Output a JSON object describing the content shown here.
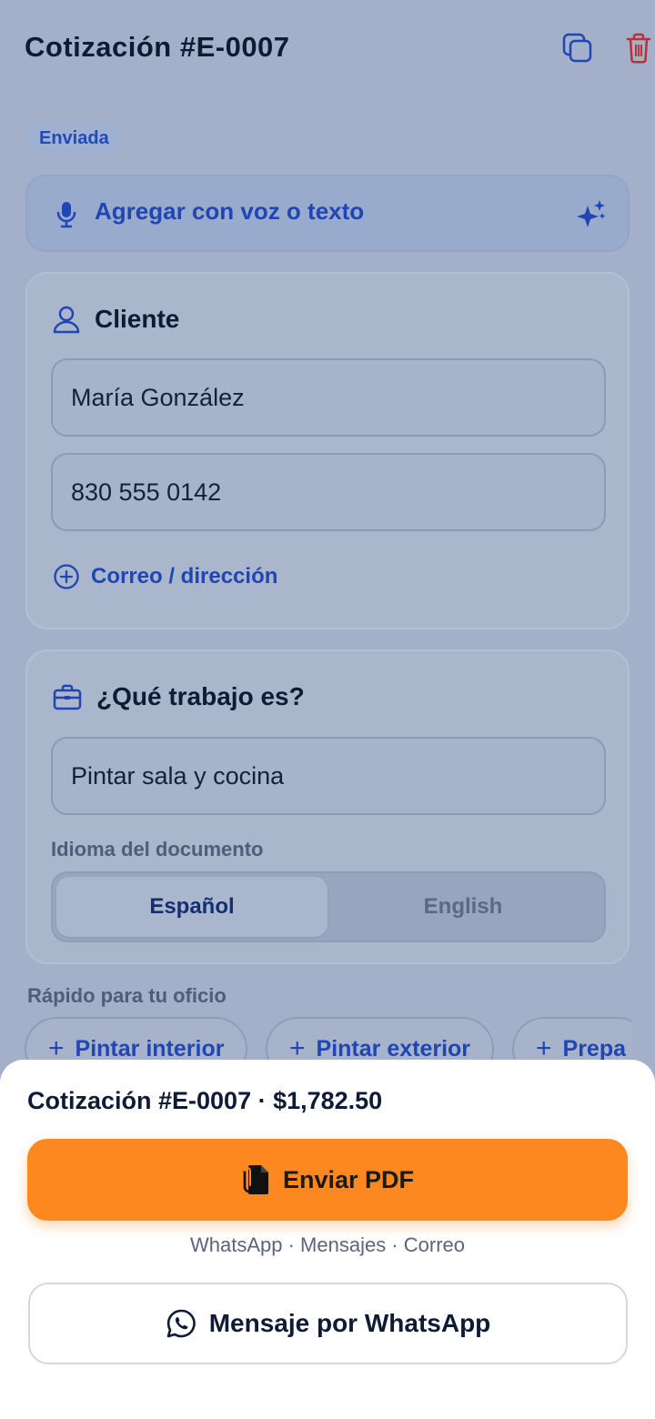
{
  "header": {
    "title": "Cotización #E-0007",
    "status_badge": "Enviada",
    "icons": {
      "duplicate": "copy-icon",
      "delete": "trash-icon"
    },
    "colors": {
      "duplicate": "#1f46b4",
      "delete": "#c0392b"
    }
  },
  "voice_input": {
    "label": "Agregar con voz o texto",
    "icons": {
      "left": "microphone-icon",
      "right": "sparkles-icon"
    }
  },
  "client_card": {
    "title": "Cliente",
    "icon": "user-icon",
    "name_value": "María González",
    "phone_value": "830 555 0142",
    "add_more_label": "Correo / dirección",
    "add_more_icon": "plus-circle-icon"
  },
  "job_card": {
    "title": "¿Qué trabajo es?",
    "icon": "briefcase-icon",
    "job_value": "Pintar sala y cocina",
    "language_label": "Idioma del documento",
    "language_options": [
      "Español",
      "English"
    ],
    "language_selected": "Español"
  },
  "quick_trades": {
    "label": "Rápido para tu oficio",
    "chips": [
      "Pintar interior",
      "Pintar exterior",
      "Prepa"
    ]
  },
  "bottom_sheet": {
    "summary": "Cotización #E-0007 · $1,782.50",
    "send_pdf_label": "Enviar PDF",
    "send_pdf_icon": "pdf-document-icon",
    "channels_text": "WhatsApp · Mensajes · Correo",
    "whatsapp_label": "Mensaje por WhatsApp",
    "whatsapp_icon": "whatsapp-icon",
    "accent_color": "#fd8820"
  }
}
